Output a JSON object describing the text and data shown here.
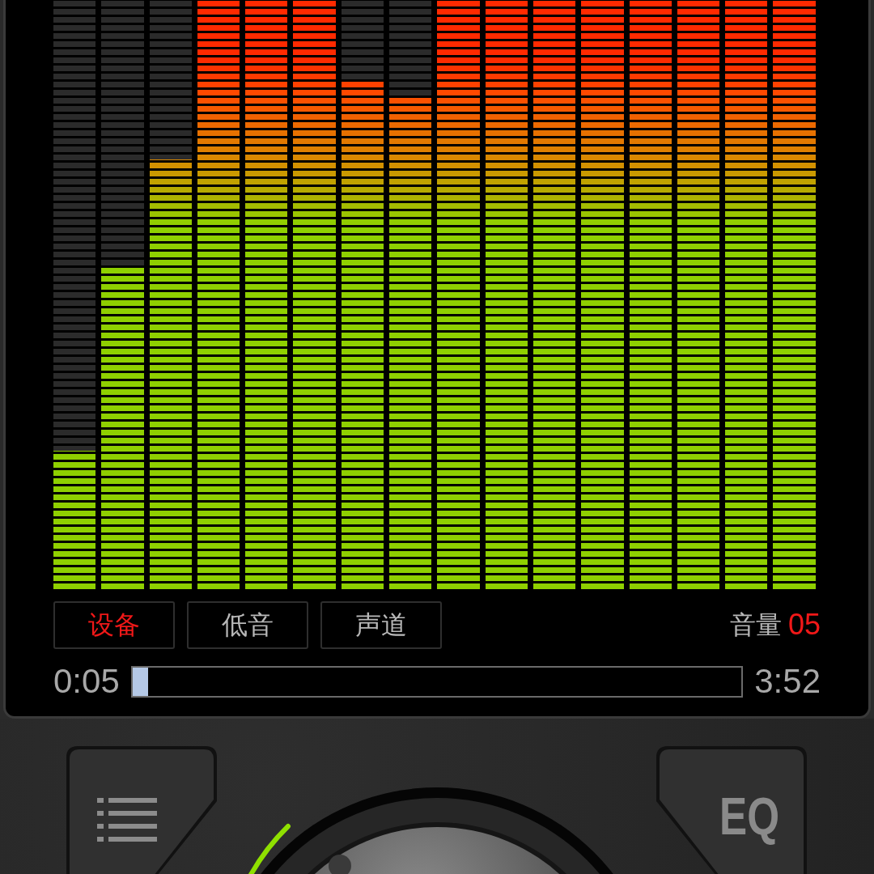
{
  "meter": {
    "bands": [
      {
        "level": 0.235
      },
      {
        "level": 0.547
      },
      {
        "level": 0.73
      },
      {
        "level": 1.0
      },
      {
        "level": 1.0
      },
      {
        "level": 1.0
      },
      {
        "level": 0.863
      },
      {
        "level": 0.837
      },
      {
        "level": 1.0
      },
      {
        "level": 1.0
      },
      {
        "level": 1.0
      },
      {
        "level": 1.0
      },
      {
        "level": 1.0
      },
      {
        "level": 1.0
      },
      {
        "level": 1.0
      },
      {
        "level": 1.0
      }
    ]
  },
  "tabs": [
    {
      "label": "设备",
      "selected": true
    },
    {
      "label": "低音",
      "selected": false
    },
    {
      "label": "声道",
      "selected": false
    }
  ],
  "volume": {
    "label": "音量",
    "value": "05"
  },
  "playback": {
    "elapsed": "0:05",
    "level": 0.025,
    "total": "3:52"
  },
  "eq_button": {
    "label": "EQ"
  }
}
